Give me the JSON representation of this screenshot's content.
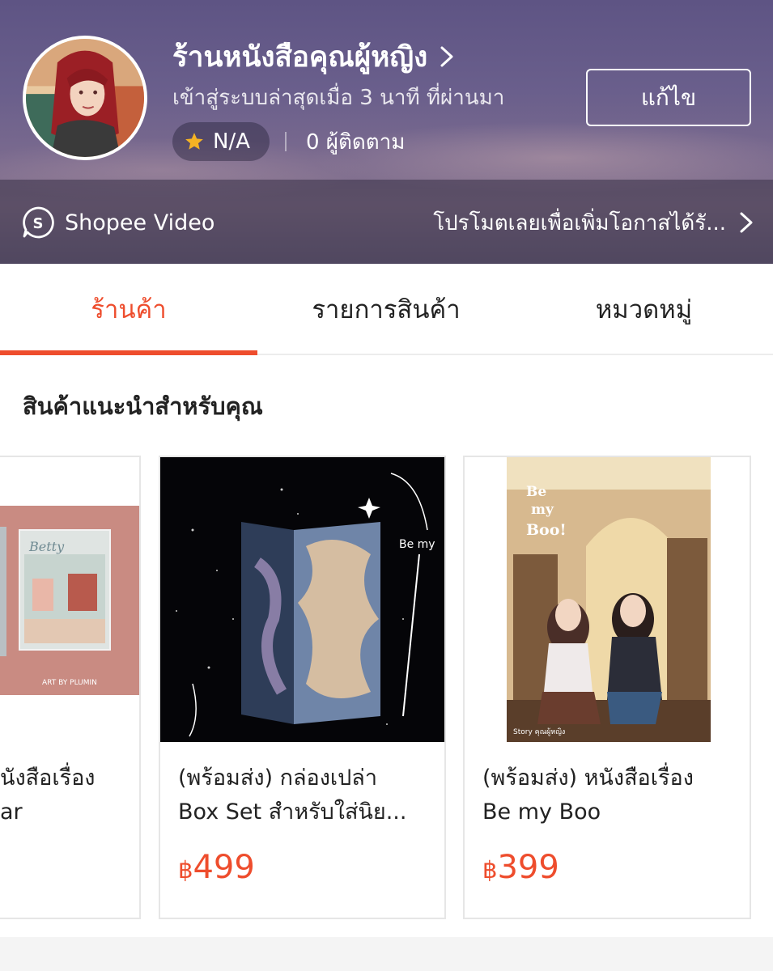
{
  "shop": {
    "name": "ร้านหนังสือคุณผู้หญิง",
    "last_seen": "เข้าสู่ระบบล่าสุดเมื่อ 3 นาที ที่ผ่านมา",
    "rating": "N/A",
    "followers": "0 ผู้ติดตาม",
    "edit_label": "แก้ไข"
  },
  "video_bar": {
    "label": "Shopee Video",
    "promo": "โปรโมตเลยเพื่อเพิ่มโอกาสได้รั..."
  },
  "tabs": [
    {
      "label": "ร้านค้า",
      "active": true
    },
    {
      "label": "รายการสินค้า",
      "active": false
    },
    {
      "label": "หมวดหมู่",
      "active": false
    }
  ],
  "section": {
    "title": "สินค้าแนะนำสำหรับคุณ"
  },
  "products": [
    {
      "title_line1": "นังสือเรื่อง",
      "title_line2": "ar",
      "price": ""
    },
    {
      "title_line1": "(พร้อมส่ง) กล่องเปล่า",
      "title_line2": "Box Set สำหรับใส่นิย...",
      "currency": "฿",
      "price": "499"
    },
    {
      "title_line1": "(พร้อมส่ง) หนังสือเรื่อง",
      "title_line2": "Be my Boo",
      "currency": "฿",
      "price": "399"
    }
  ],
  "cover_texts": {
    "box_title": "Be my",
    "boo_title": "Be my Boo!",
    "boo_credit": "Story คุณผู้หญิง",
    "art_credit": "ART BY PLUMIN"
  },
  "colors": {
    "accent": "#ee4d2d",
    "header": "#5e5484",
    "star": "#f5b324"
  },
  "icons": {
    "video": "shopee-video-icon",
    "chevron": "chevron-right-icon",
    "star": "star-icon"
  }
}
